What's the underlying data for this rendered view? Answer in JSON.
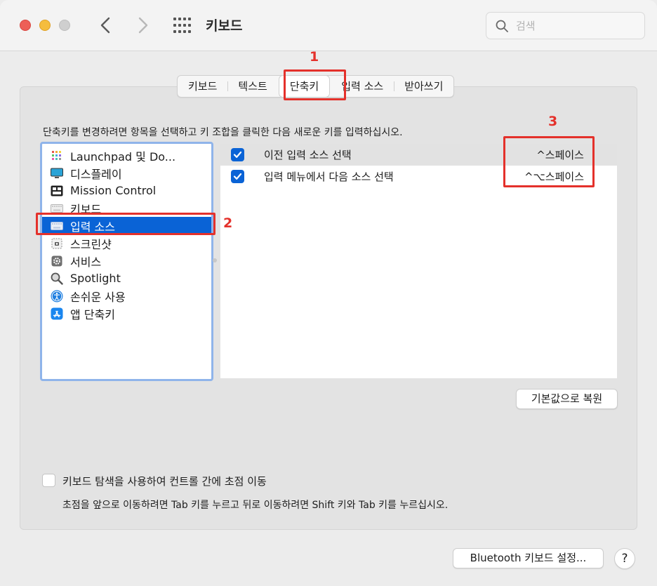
{
  "window": {
    "title": "키보드"
  },
  "search": {
    "placeholder": "검색"
  },
  "tabs": [
    {
      "label": "키보드"
    },
    {
      "label": "텍스트"
    },
    {
      "label": "단축키",
      "active": true
    },
    {
      "label": "입력 소스"
    },
    {
      "label": "받아쓰기"
    }
  ],
  "instruction": "단축키를 변경하려면 항목을 선택하고 키 조합을 클릭한 다음 새로운 키를 입력하십시오.",
  "categories": [
    {
      "label": "Launchpad 및 Do...",
      "icon": "launchpad-icon"
    },
    {
      "label": "디스플레이",
      "icon": "display-icon"
    },
    {
      "label": "Mission Control",
      "icon": "mission-control-icon"
    },
    {
      "label": "키보드",
      "icon": "keyboard-icon"
    },
    {
      "label": "입력 소스",
      "icon": "input-source-icon",
      "selected": true
    },
    {
      "label": "스크린샷",
      "icon": "screenshot-icon"
    },
    {
      "label": "서비스",
      "icon": "gear-icon"
    },
    {
      "label": "Spotlight",
      "icon": "magnifier-icon"
    },
    {
      "label": "손쉬운 사용",
      "icon": "accessibility-icon"
    },
    {
      "label": "앱 단축키",
      "icon": "app-store-icon"
    }
  ],
  "shortcuts": [
    {
      "label": "이전 입력 소스 선택",
      "key": "^스페이스",
      "checked": true
    },
    {
      "label": "입력 메뉴에서 다음 소스 선택",
      "key": "^⌥스페이스",
      "checked": true
    }
  ],
  "buttons": {
    "restore_defaults": "기본값으로 복원",
    "bluetooth": "Bluetooth 키보드 설정...",
    "help": "?"
  },
  "keyboard_nav": {
    "label": "키보드 탐색을 사용하여 컨트롤 간에 초점 이동",
    "checked": false,
    "hint": "초점을 앞으로 이동하려면 Tab 키를 누르고 뒤로 이동하려면 Shift 키와 Tab 키를 누르십시오."
  },
  "annotations": [
    "1",
    "2",
    "3"
  ],
  "colors": {
    "accent": "#0a63d6",
    "annotation": "#e4312b",
    "list_focus_border": "#8fb4ea"
  }
}
